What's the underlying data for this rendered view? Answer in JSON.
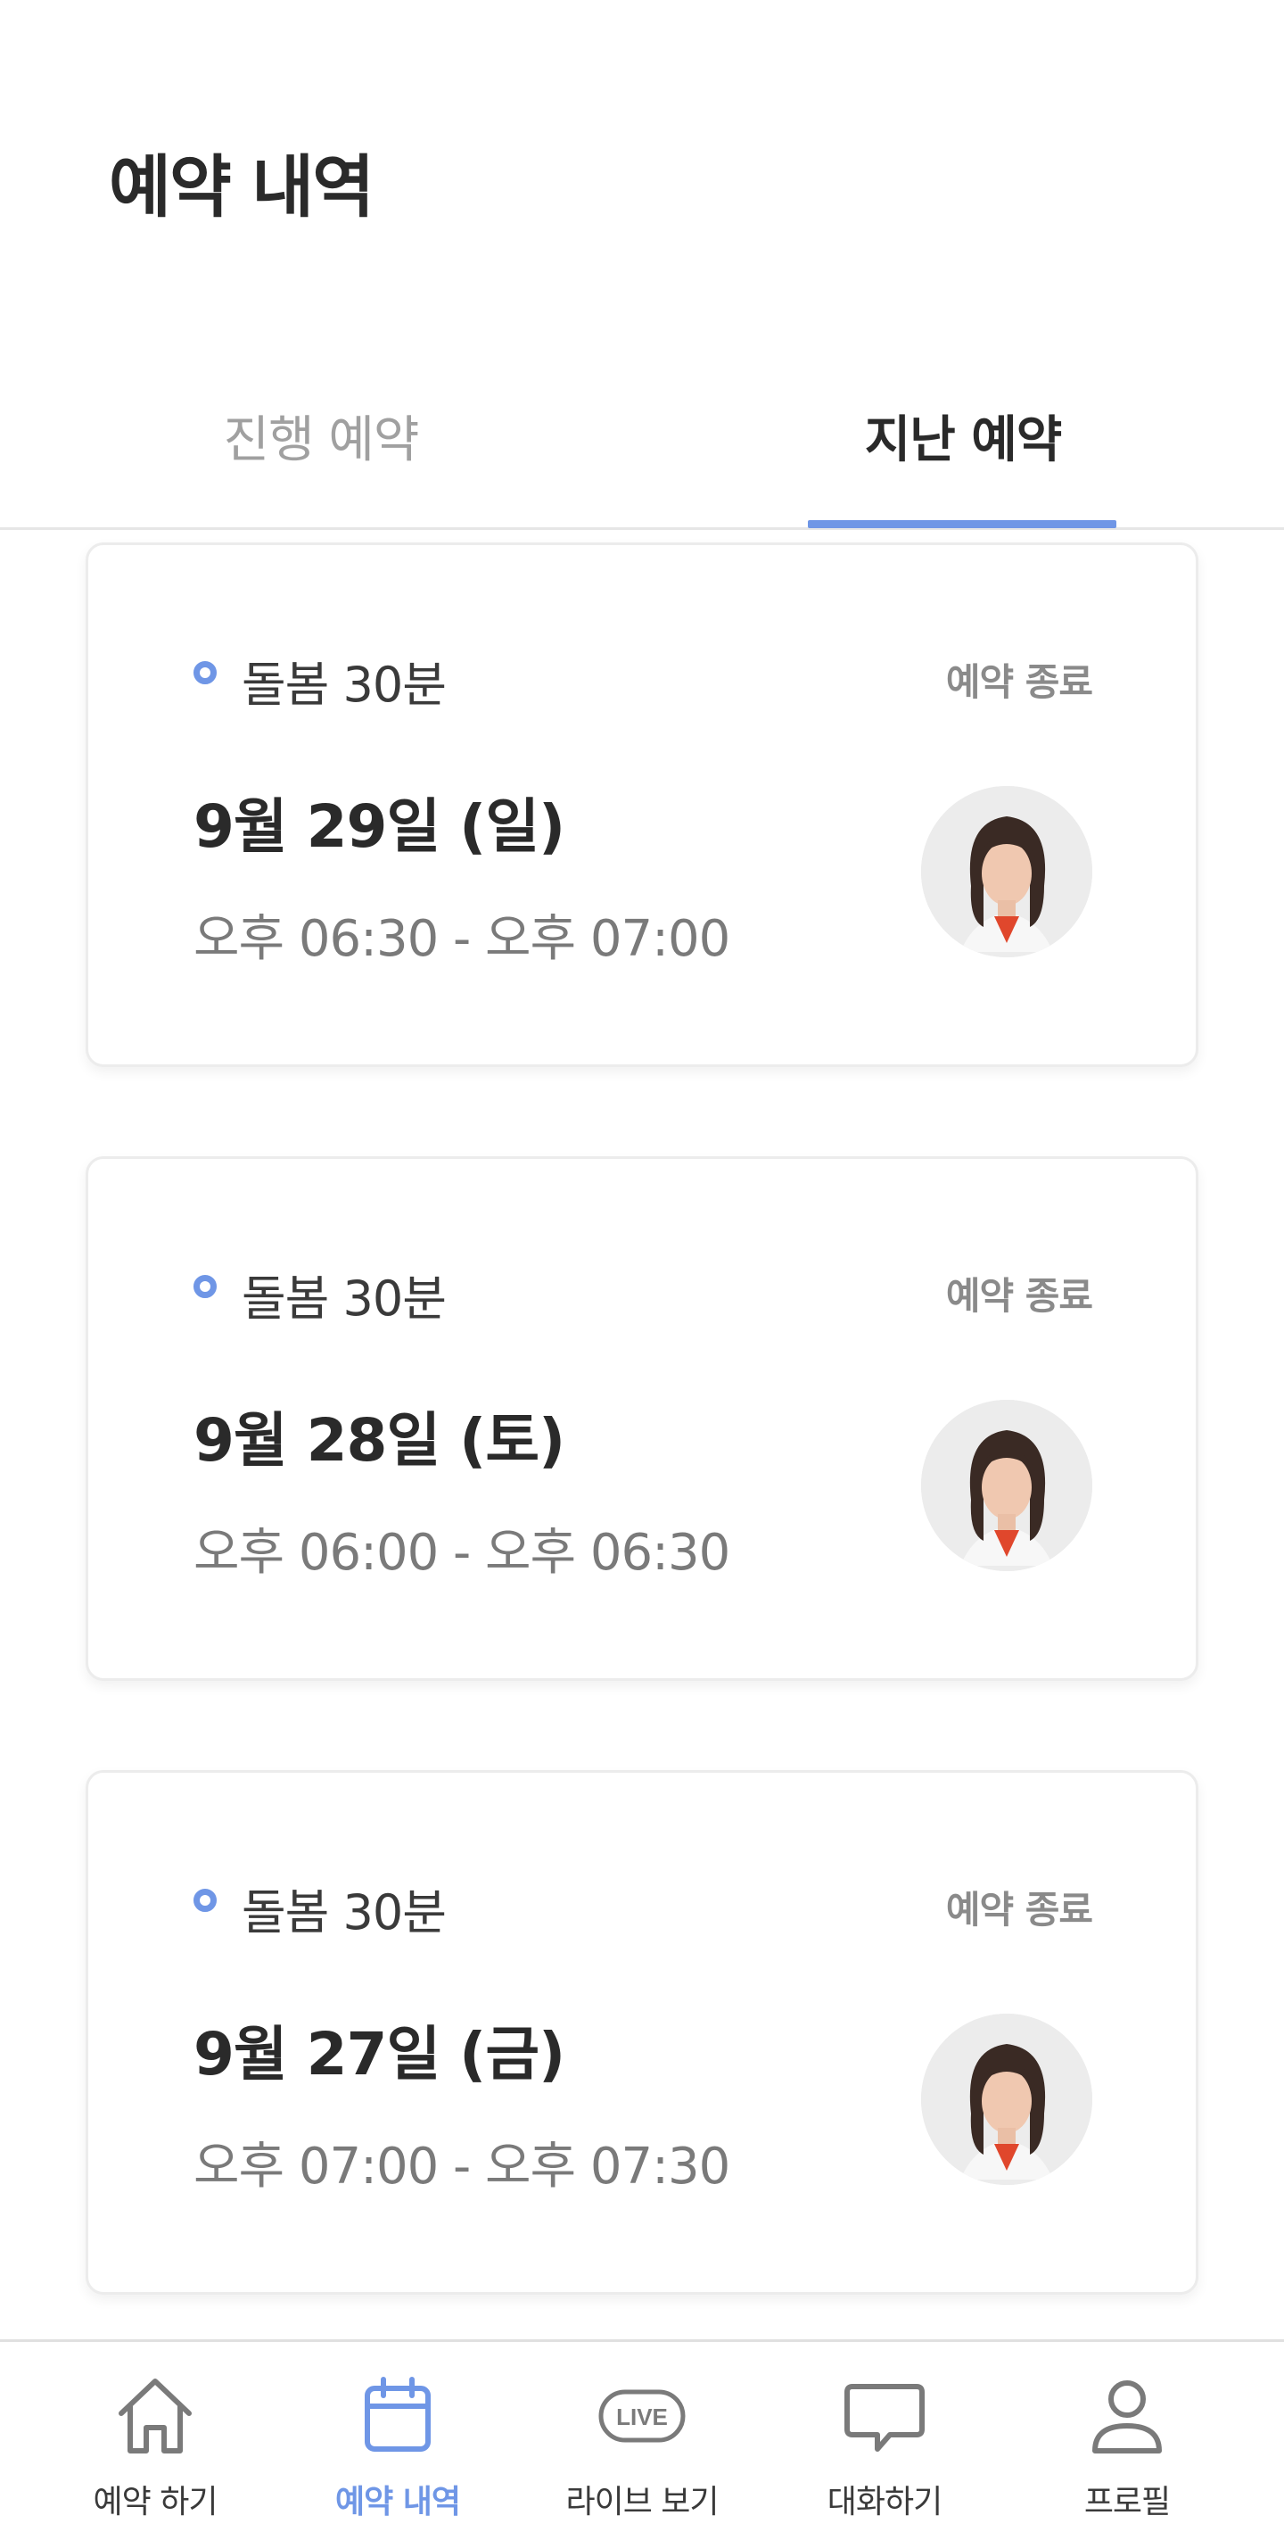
{
  "header": {
    "title": "예약 내역"
  },
  "tabs": [
    {
      "label": "진행 예약",
      "active": false
    },
    {
      "label": "지난 예약",
      "active": true
    }
  ],
  "reservations": [
    {
      "service": "돌봄 30분",
      "status": "예약 종료",
      "date": "9월 29일 (일)",
      "time": "오후 06:30 - 오후 07:00"
    },
    {
      "service": "돌봄 30분",
      "status": "예약 종료",
      "date": "9월 28일 (토)",
      "time": "오후 06:00 - 오후 06:30"
    },
    {
      "service": "돌봄 30분",
      "status": "예약 종료",
      "date": "9월 27일 (금)",
      "time": "오후 07:00 - 오후 07:30"
    }
  ],
  "bottom_nav": [
    {
      "label": "예약 하기",
      "icon": "home-icon",
      "active": false
    },
    {
      "label": "예약 내역",
      "icon": "calendar-icon",
      "active": true
    },
    {
      "label": "라이브 보기",
      "icon": "live-icon",
      "icon_text": "LIVE",
      "active": false
    },
    {
      "label": "대화하기",
      "icon": "chat-bubble-icon",
      "active": false
    },
    {
      "label": "프로필",
      "icon": "person-icon",
      "active": false
    }
  ],
  "colors": {
    "accent": "#6f96e6",
    "text_primary": "#2a2a2a",
    "text_muted": "#8a8a8a",
    "divider": "#e6e6e6"
  }
}
